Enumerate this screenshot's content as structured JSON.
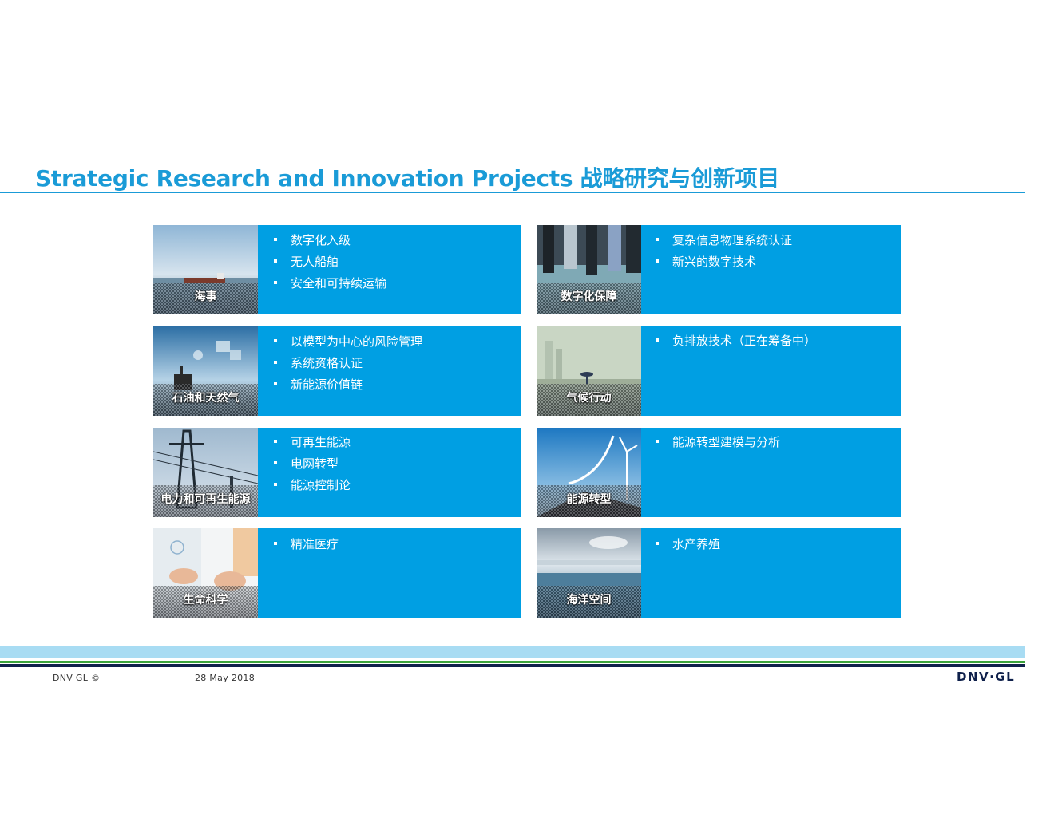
{
  "title": "Strategic Research and Innovation Projects 战略研究与创新项目",
  "cards": [
    {
      "label": "海事",
      "bullets": [
        "数字化入级",
        "无人船舶",
        "安全和可持续运输"
      ]
    },
    {
      "label": "数字化保障",
      "bullets": [
        "复杂信息物理系统认证",
        "新兴的数字技术"
      ]
    },
    {
      "label": "石油和天然气",
      "bullets": [
        "以模型为中心的风险管理",
        "系统资格认证",
        "新能源价值链"
      ]
    },
    {
      "label": "气候行动",
      "bullets": [
        "负排放技术（正在筹备中）"
      ]
    },
    {
      "label": "电力和可再生能源",
      "bullets": [
        "可再生能源",
        "电网转型",
        "能源控制论"
      ]
    },
    {
      "label": "能源转型",
      "bullets": [
        "能源转型建模与分析"
      ]
    },
    {
      "label": "生命科学",
      "bullets": [
        "精准医疗"
      ]
    },
    {
      "label": "海洋空间",
      "bullets": [
        "水产养殖"
      ]
    }
  ],
  "footer": {
    "copyright": "DNV GL ©",
    "date": "28 May 2018",
    "logo": "DNV·GL"
  },
  "colors": {
    "accent": "#1a9bd7",
    "card": "#009fe3",
    "navy": "#0f204b",
    "green": "#3ba33b",
    "light_band": "#a8dcf3"
  }
}
